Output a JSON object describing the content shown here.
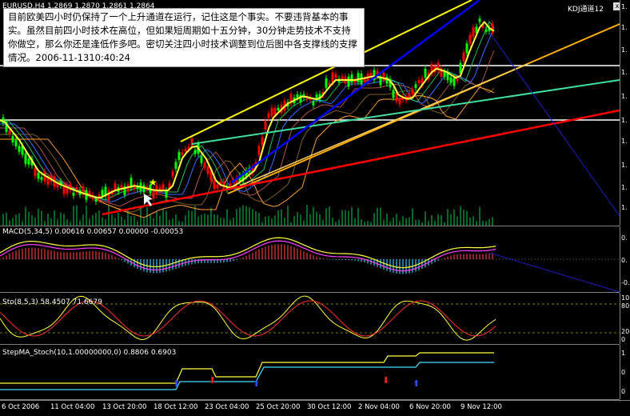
{
  "main": {
    "header": "EURUSD,H4  1.2869 1.2870 1.2861 1.2864",
    "annotation": "目前欧美四小时仍保持了一个上升通道在运行，记住这是个事实。不要违背基本的事实。虽然目前四小时技术在高位，但如果短周期如十五分钟，30分钟走势技术不支持你做空，那么你还是逢低作多吧。密切关注四小时技术调整到位后图中各支撑线的支撑情况。2006-11-1310:40:24",
    "indicator_tag": "KDJ通道12",
    "close_glyph": "x",
    "scale_ticks": [
      "1.",
      "1.",
      "1.",
      "1.",
      "1.",
      "1.",
      "1.",
      "1.",
      "1.",
      "1."
    ]
  },
  "macd": {
    "header": "MACD(5,34,5)  0.00616  0.00657  0.00000  -0.00053",
    "scale_ticks": [
      "0.",
      "0.",
      "-0."
    ]
  },
  "sto": {
    "header": "Sto(8,5,3)  58.4507  71.6679",
    "scale_ticks": [
      "10",
      "80",
      "20",
      "0"
    ]
  },
  "stepma": {
    "header": "StepMA_Stoch(10,1.00000000,0)  0.8806  0.6903",
    "scale_ticks": [
      "1",
      "0",
      "0"
    ]
  },
  "time_axis": [
    "6 Oct 2006",
    "11 Oct 04:00",
    "13 Oct 20:00",
    "18 Oct 12:00",
    "23 Oct 04:00",
    "25 Oct 20:00",
    "30 Oct 12:00",
    "2 Nov 04:00",
    "6 Nov 20:00",
    "9 Nov 12:00"
  ],
  "colors": {
    "bull": "#00ff00",
    "bear": "#ff0000",
    "ma_yellow": "#ffff00",
    "channel_yellow": "#ffff00",
    "channel_orange": "#ffb000",
    "trend_blue": "#0000ff",
    "trend_red": "#ff0000",
    "trend_teal": "#40e0a0",
    "macd_signal": "#ff40ff"
  }
}
